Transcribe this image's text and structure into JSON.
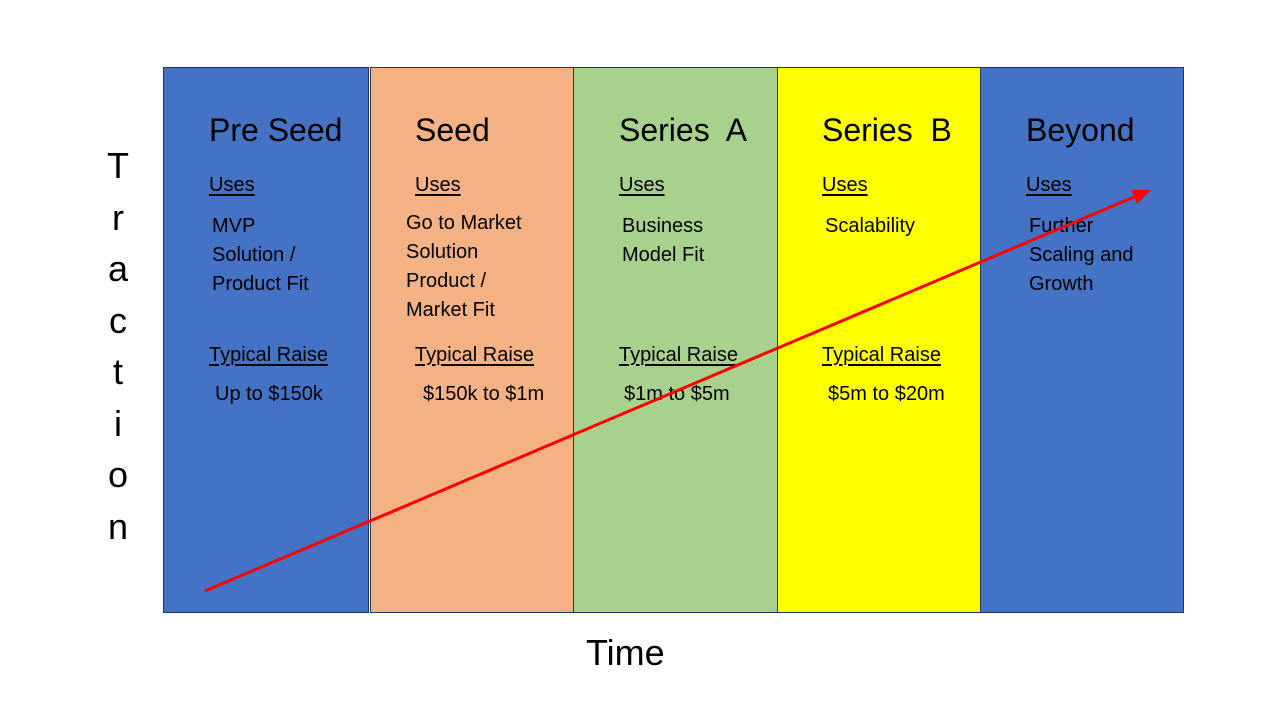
{
  "axes": {
    "y_label": "Traction",
    "x_label": "Time"
  },
  "arrow": {
    "color": "#ff0000",
    "direction": "upward trend from bottom-left to top-right"
  },
  "stages": [
    {
      "title": "Pre Seed",
      "color": "#4472c4",
      "uses_label": "Uses",
      "uses_text": "MVP\nSolution /\nProduct Fit",
      "raise_label": "Typical Raise",
      "raise_value": "Up to $150k"
    },
    {
      "title": "Seed",
      "color": "#f4b183",
      "uses_label": "Uses",
      "uses_text": "Go to Market\nSolution\nProduct /\nMarket Fit",
      "raise_label": "Typical Raise",
      "raise_value": "$150k to $1m"
    },
    {
      "title": "Series  A",
      "color": "#a9d18e",
      "uses_label": "Uses",
      "uses_text": "Business\nModel Fit",
      "raise_label": "Typical Raise",
      "raise_value": "$1m to $5m"
    },
    {
      "title": "Series  B",
      "color": "#ffff00",
      "uses_label": "Uses",
      "uses_text": "Scalability",
      "raise_label": "Typical Raise",
      "raise_value": "$5m to $20m"
    },
    {
      "title": "Beyond",
      "color": "#4472c4",
      "uses_label": "Uses",
      "uses_text": "Further\nScaling and\nGrowth",
      "raise_label": "",
      "raise_value": ""
    }
  ]
}
